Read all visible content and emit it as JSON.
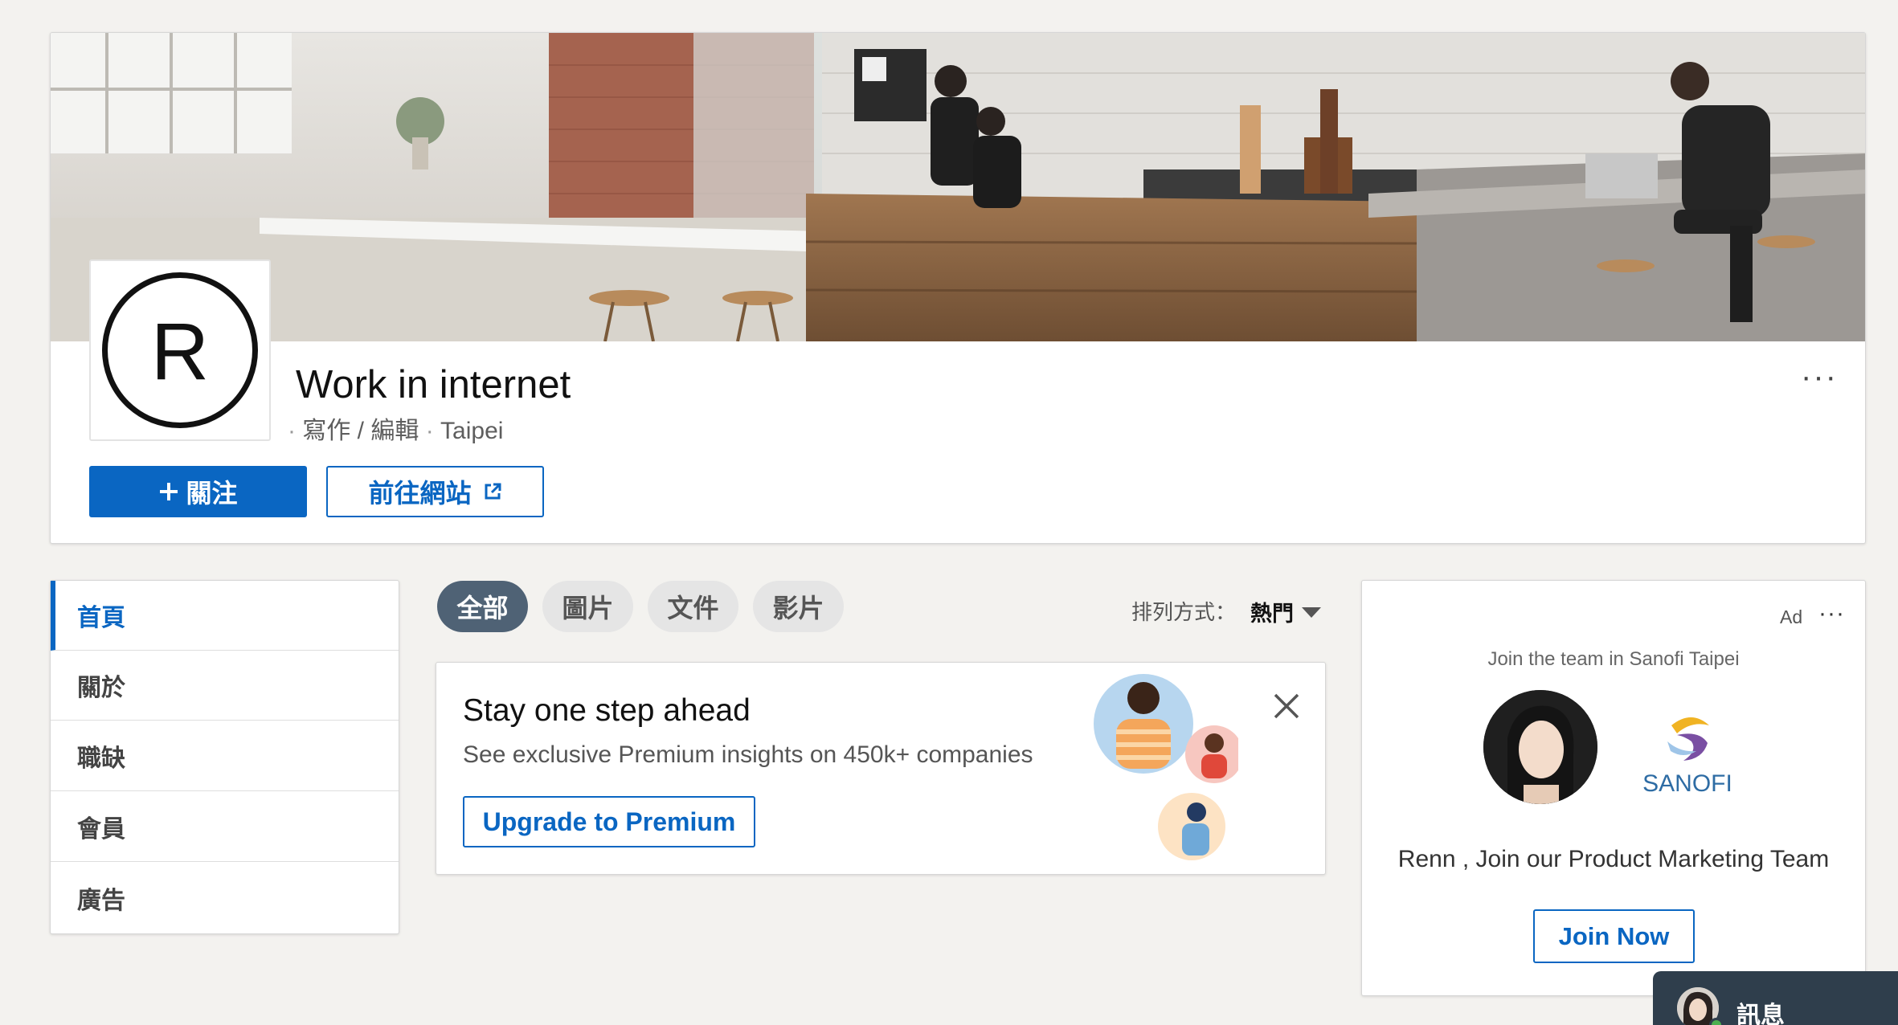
{
  "company": {
    "logo_letter": "R",
    "name": "Work in internet",
    "industry": "寫作 / 編輯",
    "location": "Taipei",
    "separator": "·",
    "more_icon": "ellipsis-icon"
  },
  "actions": {
    "follow_label": "關注",
    "follow_icon": "plus-icon",
    "website_label": "前往網站",
    "website_icon": "external-link-icon"
  },
  "nav": {
    "items": [
      {
        "label": "首頁",
        "active": true
      },
      {
        "label": "關於",
        "active": false
      },
      {
        "label": "職缺",
        "active": false
      },
      {
        "label": "會員",
        "active": false
      },
      {
        "label": "廣告",
        "active": false
      }
    ]
  },
  "filters": {
    "pills": [
      {
        "label": "全部",
        "active": true
      },
      {
        "label": "圖片",
        "active": false
      },
      {
        "label": "文件",
        "active": false
      },
      {
        "label": "影片",
        "active": false
      }
    ],
    "sort_label": "排列方式：",
    "sort_value": "熱門"
  },
  "premium": {
    "title": "Stay one step ahead",
    "subtitle": "See exclusive Premium insights on 450k+ companies",
    "button_label": "Upgrade to Premium"
  },
  "ad": {
    "label": "Ad",
    "headline": "Join the team in Sanofi Taipei",
    "brand_name": "SANOFI",
    "body": "Renn , Join our Product Marketing Team",
    "button_label": "Join Now"
  },
  "messaging": {
    "label": "訊息"
  },
  "colors": {
    "accent": "#0a66c2",
    "background": "#f3f2ef",
    "pill_active": "#4f6275",
    "messaging_bar": "#2f3e4c"
  }
}
